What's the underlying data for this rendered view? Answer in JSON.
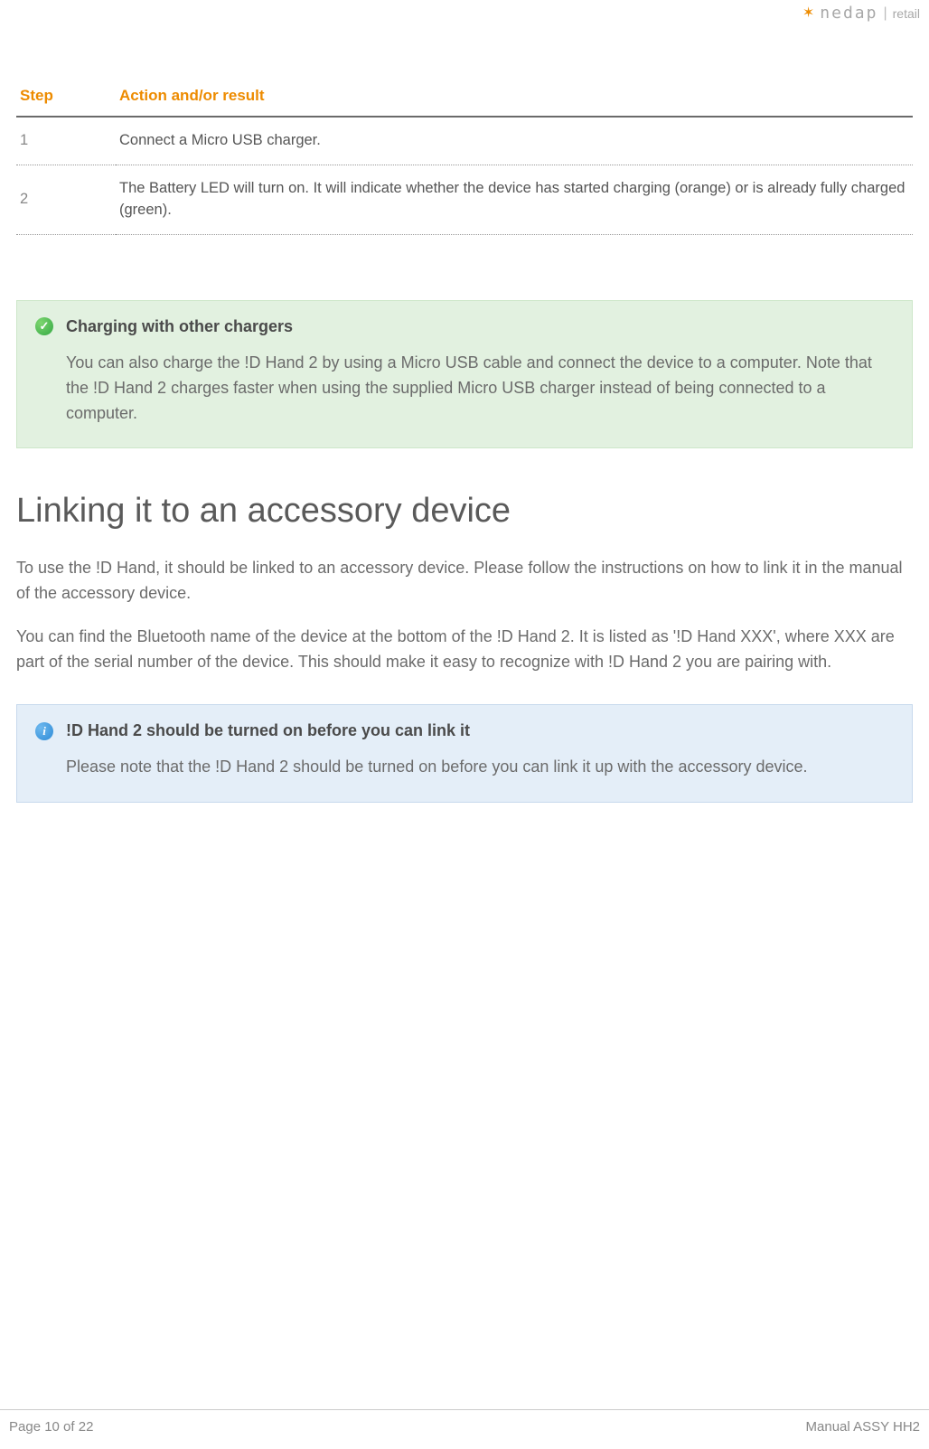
{
  "logo": {
    "brand": "nedap",
    "suffix": "retail"
  },
  "table": {
    "headers": {
      "step": "Step",
      "action": "Action and/or result"
    },
    "rows": [
      {
        "num": "1",
        "action": "Connect a Micro USB charger."
      },
      {
        "num": "2",
        "action": "The Battery LED will turn on. It will indicate whether the device has started charging (orange) or is already fully charged (green)."
      }
    ]
  },
  "tip": {
    "icon_glyph": "✓",
    "title": "Charging with other chargers",
    "body": "You can also charge the !D Hand 2 by using a Micro USB cable and connect the device to a computer. Note that the !D Hand 2 charges faster when using the supplied Micro USB charger instead of being connected to a computer."
  },
  "section_heading": "Linking it to an accessory device",
  "para1": "To use the !D Hand, it should be linked to an accessory device. Please follow the instructions on how to link it in the manual of the accessory device.",
  "para2": "You can find the Bluetooth name of the device at the bottom of the !D Hand 2. It is listed as '!D Hand XXX', where XXX are part of the serial number of the device. This should make it easy to recognize with !D Hand 2 you are pairing with.",
  "info": {
    "icon_glyph": "i",
    "title": "!D Hand 2 should be turned on before you can link it",
    "body": "Please note that the !D Hand 2 should be turned on before you can link it up with the accessory device."
  },
  "footer": {
    "left": "Page 10 of 22",
    "right": "Manual ASSY HH2"
  }
}
